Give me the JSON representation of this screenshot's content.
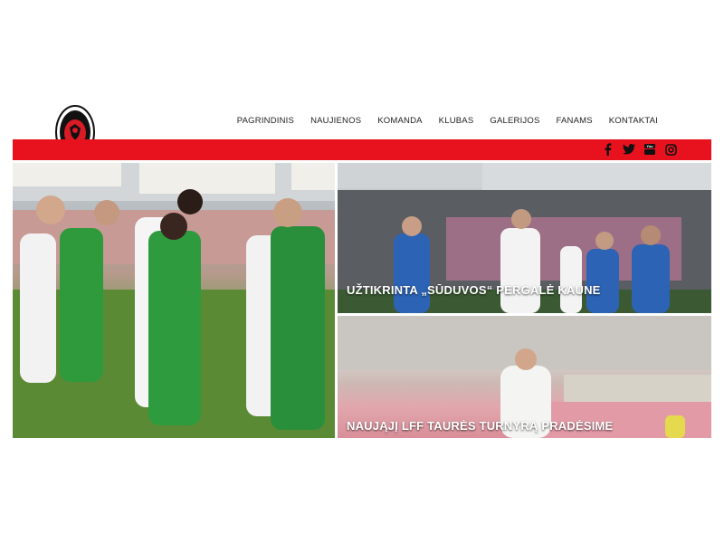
{
  "nav": {
    "items": [
      "PAGRINDINIS",
      "NAUJIENOS",
      "KOMANDA",
      "KLUBAS",
      "GALERIJOS",
      "FANAMS",
      "KONTAKTAI"
    ]
  },
  "social": [
    "facebook-icon",
    "twitter-icon",
    "youtube-icon",
    "instagram-icon"
  ],
  "colors": {
    "accent": "#e8121f"
  },
  "featured": [
    {
      "title": "UŽTIKRINTA „SŪDUVOS“ PERGALĖ KAUNE"
    },
    {
      "title": "NAUJĄJĮ LFF TAURĖS TURNYRĄ PRADĖSIME"
    }
  ]
}
